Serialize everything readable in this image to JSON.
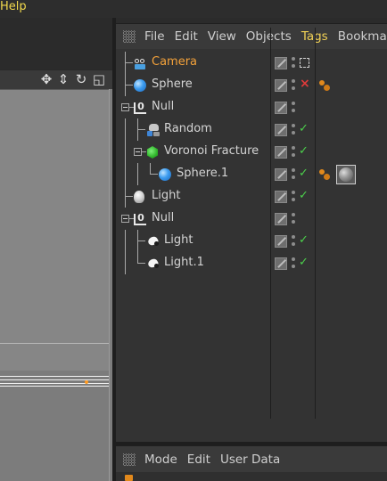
{
  "app_menu": {
    "help": "Help"
  },
  "object_manager": {
    "menu": [
      {
        "label": "File",
        "active": false
      },
      {
        "label": "Edit",
        "active": false
      },
      {
        "label": "View",
        "active": false
      },
      {
        "label": "Objects",
        "active": false
      },
      {
        "label": "Tags",
        "active": true
      },
      {
        "label": "Bookmarks",
        "active": false
      }
    ],
    "objects": [
      {
        "name": "Camera",
        "icon": "camera-icon",
        "depth": 0,
        "expander": false,
        "selected_color": true,
        "status": "solo",
        "tags": []
      },
      {
        "name": "Sphere",
        "icon": "sphere-icon",
        "depth": 0,
        "expander": false,
        "selected_color": false,
        "status": "disabled",
        "tags": [
          "phong-tag-icon"
        ]
      },
      {
        "name": "Null",
        "icon": "null-icon",
        "depth": 0,
        "expander": true,
        "selected_color": false,
        "status": "none",
        "tags": []
      },
      {
        "name": "Random",
        "icon": "random-effector-icon",
        "depth": 1,
        "expander": false,
        "selected_color": false,
        "status": "enabled",
        "tags": []
      },
      {
        "name": "Voronoi Fracture",
        "icon": "voronoi-fracture-icon",
        "depth": 1,
        "expander": true,
        "selected_color": false,
        "status": "enabled",
        "tags": []
      },
      {
        "name": "Sphere.1",
        "icon": "sphere-icon",
        "depth": 2,
        "expander": false,
        "selected_color": false,
        "status": "enabled",
        "tags": [
          "phong-tag-icon",
          "material-tag-icon"
        ]
      },
      {
        "name": "Light",
        "icon": "light-bulb-icon",
        "depth": 0,
        "expander": false,
        "selected_color": false,
        "status": "enabled",
        "tags": []
      },
      {
        "name": "Null",
        "icon": "null-icon",
        "depth": 0,
        "expander": true,
        "selected_color": false,
        "status": "none",
        "tags": []
      },
      {
        "name": "Light",
        "icon": "spot-light-icon",
        "depth": 1,
        "expander": false,
        "selected_color": false,
        "status": "enabled",
        "tags": []
      },
      {
        "name": "Light.1",
        "icon": "spot-light-icon",
        "depth": 1,
        "expander": false,
        "selected_color": false,
        "status": "enabled",
        "tags": []
      }
    ]
  },
  "attribute_manager": {
    "menu": [
      {
        "label": "Mode"
      },
      {
        "label": "Edit"
      },
      {
        "label": "User Data"
      }
    ]
  },
  "viewport": {
    "nav_icons": [
      "move-view-icon",
      "dolly-view-icon",
      "rotate-view-icon",
      "toggle-view-icon"
    ]
  },
  "colors": {
    "accent": "#f0d055",
    "selected_object": "#f4a23a",
    "enabled_check": "#4cd04c",
    "disabled_x": "#e03b3b"
  }
}
